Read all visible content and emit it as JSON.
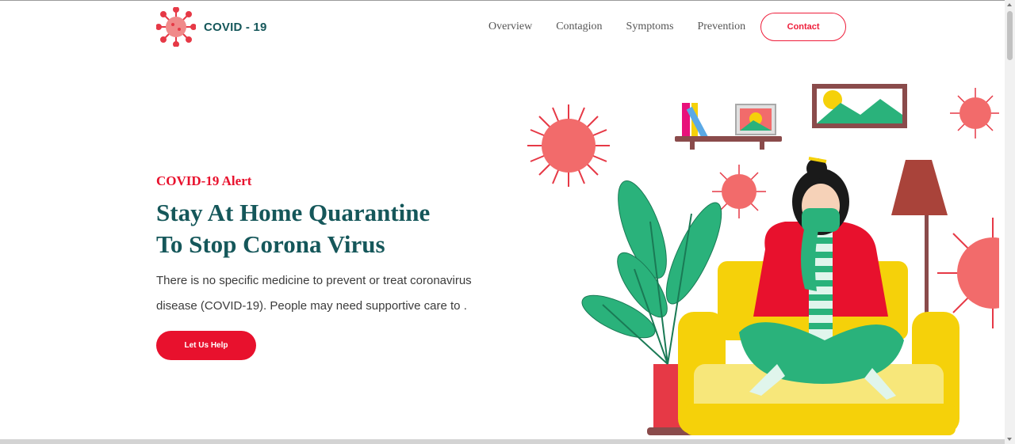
{
  "brand": {
    "name": "COVID - 19",
    "accent": "#15575a",
    "red": "#e8112d"
  },
  "nav": {
    "items": [
      {
        "label": "Overview"
      },
      {
        "label": "Contagion"
      },
      {
        "label": "Symptoms"
      },
      {
        "label": "Prevention"
      }
    ],
    "contact_label": "Contact"
  },
  "hero": {
    "alert": "COVID-19 Alert",
    "headline_line1": "Stay At Home Quarantine",
    "headline_line2": "To Stop Corona Virus",
    "description": "There is no specific medicine to prevent or treat coronavirus disease (COVID-19). People may need supportive care to .",
    "cta_label": "Let Us Help"
  },
  "illustration": {
    "subject": "woman-in-mask-on-sofa",
    "icons": [
      "virus-icon",
      "plant-icon",
      "lamp-icon",
      "shelf-icon",
      "picture-frame-icon"
    ]
  }
}
